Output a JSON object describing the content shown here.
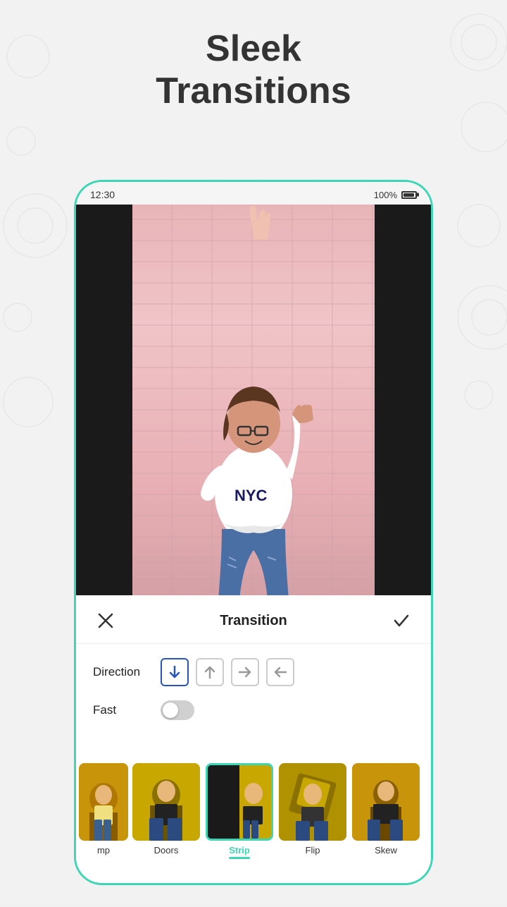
{
  "title": {
    "line1": "Sleek",
    "line2": "Transitions"
  },
  "status_bar": {
    "time": "12:30",
    "battery_text": "100%"
  },
  "transition_panel": {
    "header_title": "Transition",
    "cancel_icon": "×",
    "confirm_icon": "✓",
    "direction_label": "Direction",
    "fast_label": "Fast",
    "fast_enabled": false
  },
  "direction_buttons": [
    {
      "id": "down",
      "active": true,
      "label": "down-arrow"
    },
    {
      "id": "up",
      "active": false,
      "label": "up-arrow"
    },
    {
      "id": "right",
      "active": false,
      "label": "right-arrow"
    },
    {
      "id": "left",
      "active": false,
      "label": "left-arrow"
    }
  ],
  "thumbnails": [
    {
      "id": "bump",
      "label": "mp",
      "selected": false,
      "bg": "1"
    },
    {
      "id": "doors",
      "label": "Doors",
      "selected": false,
      "bg": "2"
    },
    {
      "id": "strip",
      "label": "Strip",
      "selected": true,
      "bg": "3"
    },
    {
      "id": "flip",
      "label": "Flip",
      "selected": false,
      "bg": "4"
    },
    {
      "id": "skew",
      "label": "Skew",
      "selected": false,
      "bg": "5"
    }
  ]
}
